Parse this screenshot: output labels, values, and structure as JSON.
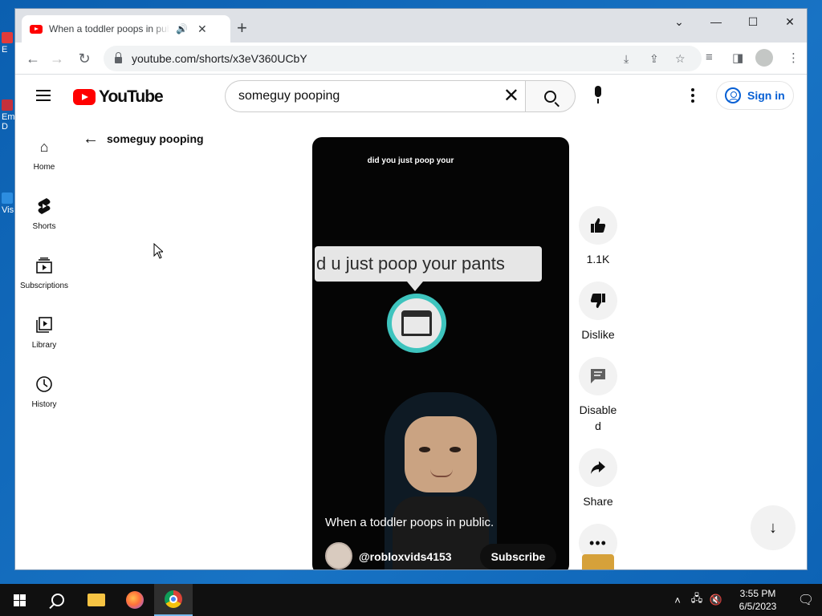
{
  "desktop": {
    "icons": [
      {
        "label": "E",
        "top": 0
      },
      {
        "label": "Em D",
        "top": 0
      },
      {
        "label": "Vis",
        "top": 0
      }
    ]
  },
  "browser": {
    "tab_title": "When a toddler poops in public",
    "url": "youtube.com/shorts/x3eV360UCbY",
    "icons": {
      "audio": "speaker-icon",
      "close_tab": "close-icon",
      "new_tab": "plus-icon",
      "back": "arrow-left-icon",
      "forward": "arrow-right-icon",
      "reload": "reload-icon",
      "lock": "lock-icon",
      "install": "install-icon",
      "share": "share-icon",
      "bookmark": "star-icon",
      "media": "media-icon",
      "side_panel": "side-panel-icon",
      "profile": "profile-icon",
      "menu": "kebab-icon"
    }
  },
  "youtube": {
    "logo_text": "YouTube",
    "search_value": "someguy pooping",
    "signin_label": "Sign in",
    "back_title": "someguy pooping",
    "sidebar": [
      {
        "label": "Home",
        "icon": "home-icon"
      },
      {
        "label": "Shorts",
        "icon": "shorts-icon"
      },
      {
        "label": "Subscriptions",
        "icon": "subscriptions-icon"
      },
      {
        "label": "Library",
        "icon": "library-icon"
      },
      {
        "label": "History",
        "icon": "history-icon"
      }
    ],
    "short": {
      "top_caption": "did you just poop your",
      "bubble_text": "d u just poop your pants",
      "title": "When a toddler poops in public.",
      "channel": "@robloxvids4153",
      "subscribe_label": "Subscribe"
    },
    "actions": {
      "like_count": "1.1K",
      "dislike_label": "Dislike",
      "comments_label": "Disabled",
      "share_label": "Share"
    }
  },
  "taskbar": {
    "time": "3:55 PM",
    "date": "6/5/2023"
  }
}
